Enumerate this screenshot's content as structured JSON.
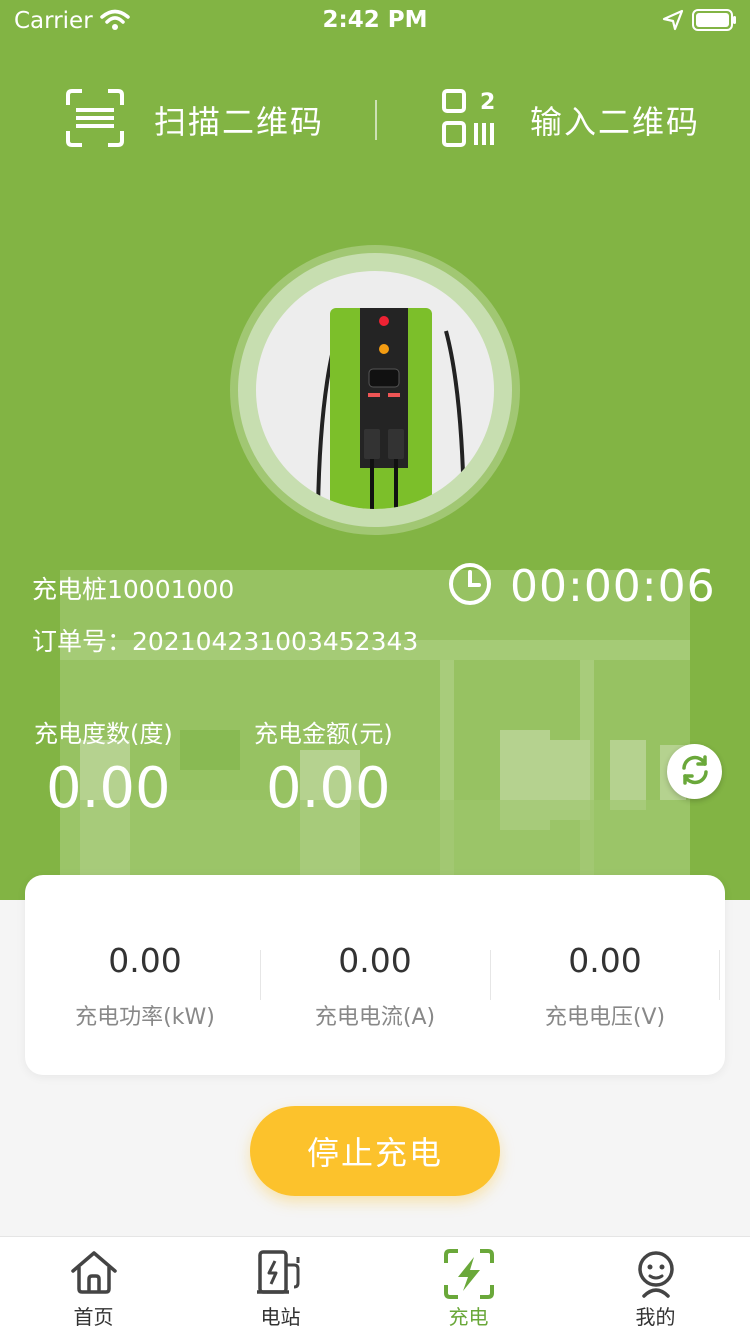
{
  "status_bar": {
    "carrier": "Carrier",
    "time": "2:42 PM"
  },
  "actions": {
    "scan_label": "扫描二维码",
    "enter_label": "输入二维码"
  },
  "charging": {
    "pile": "充电桩10001000",
    "order": "订单号：202104231003452343",
    "timer": "00:00:06",
    "energy_label": "充电度数(度)",
    "energy_value": "0.00",
    "amount_label": "充电金额(元)",
    "amount_value": "0.00"
  },
  "metrics": [
    {
      "value": "0.00",
      "label": "充电功率(kW)"
    },
    {
      "value": "0.00",
      "label": "充电电流(A)"
    },
    {
      "value": "0.00",
      "label": "充电电压(V)"
    }
  ],
  "stop_button": "停止充电",
  "tabs": [
    {
      "label": "首页",
      "icon": "home-icon"
    },
    {
      "label": "电站",
      "icon": "station-icon"
    },
    {
      "label": "充电",
      "icon": "charge-icon"
    },
    {
      "label": "我的",
      "icon": "profile-icon"
    }
  ],
  "colors": {
    "accent_green": "#82b444",
    "button_yellow": "#fcc22c",
    "active_tab": "#6aa83a"
  }
}
